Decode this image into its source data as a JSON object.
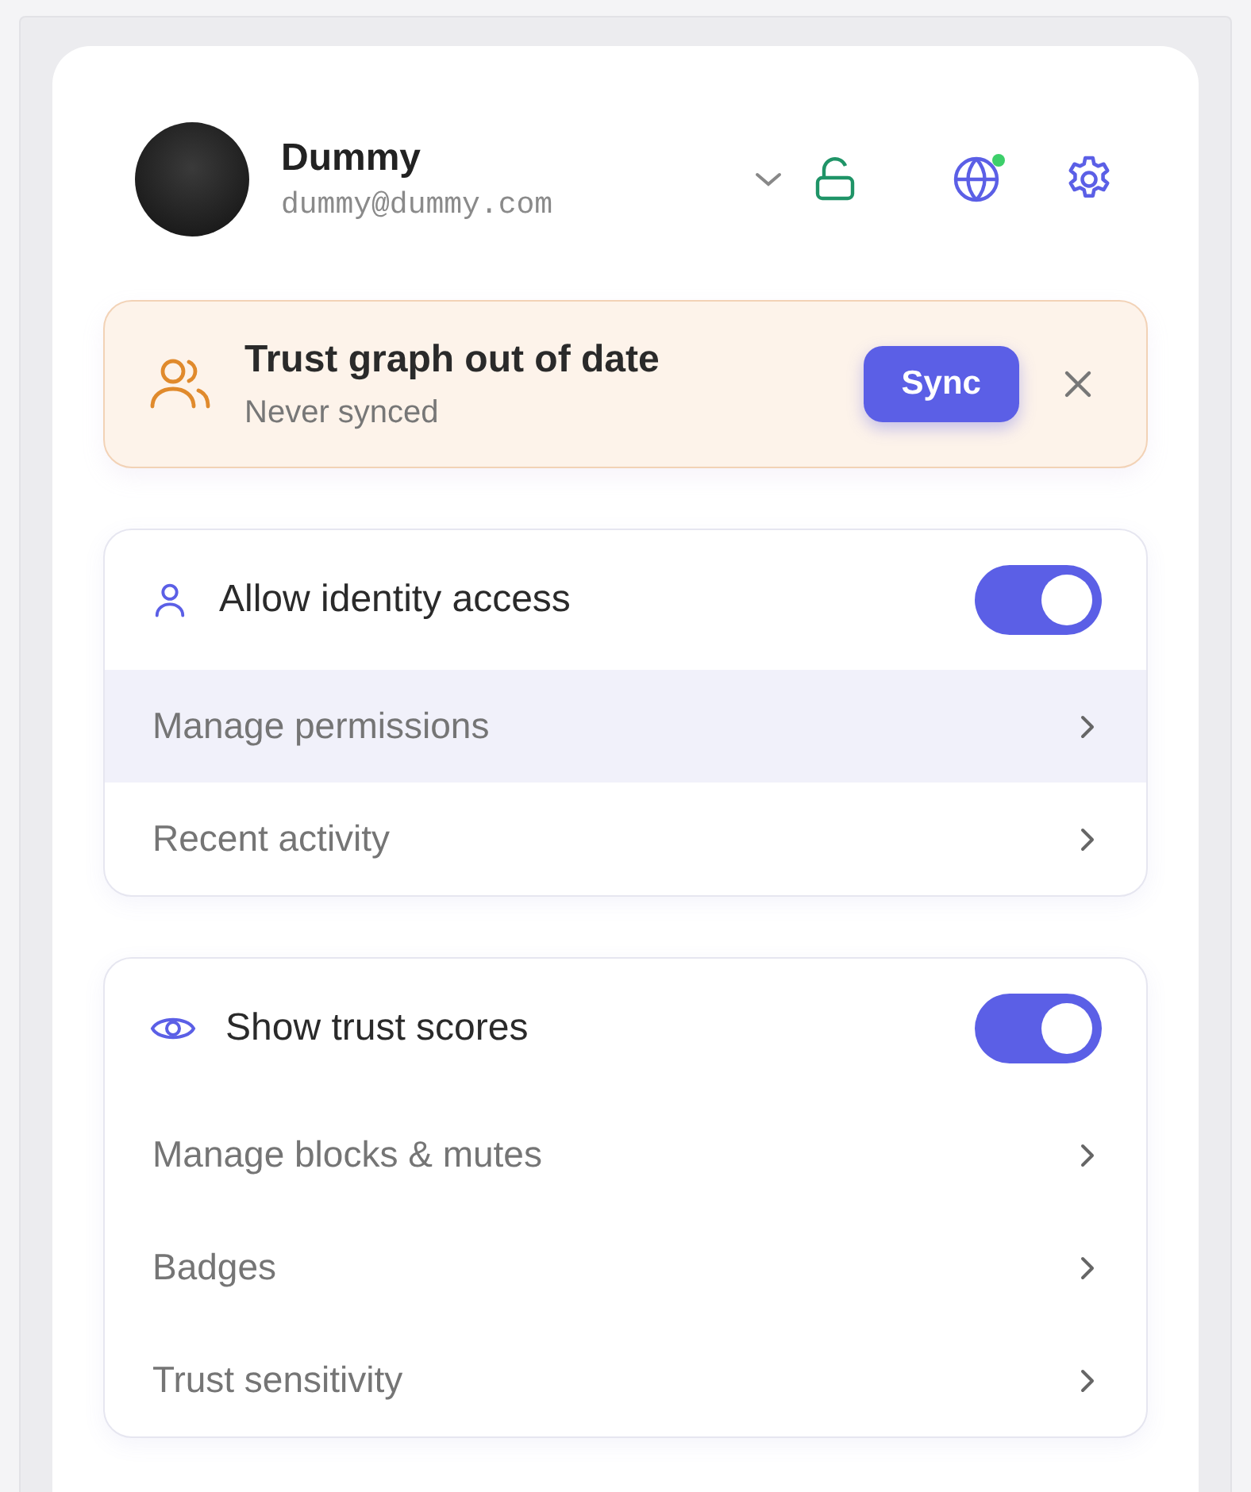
{
  "account": {
    "name": "Dummy",
    "email": "dummy@dummy.com",
    "globe_online": true
  },
  "banner": {
    "title": "Trust graph out of date",
    "subtitle": "Never synced",
    "action": "Sync"
  },
  "sections": [
    {
      "title": "Allow identity access",
      "on": true,
      "rows": [
        {
          "label": "Manage permissions",
          "highlighted": true
        },
        {
          "label": "Recent activity",
          "highlighted": false
        }
      ]
    },
    {
      "title": "Show trust scores",
      "on": true,
      "rows": [
        {
          "label": "Manage blocks & mutes",
          "highlighted": false
        },
        {
          "label": "Badges",
          "highlighted": false
        },
        {
          "label": "Trust sensitivity",
          "highlighted": false
        }
      ]
    }
  ]
}
